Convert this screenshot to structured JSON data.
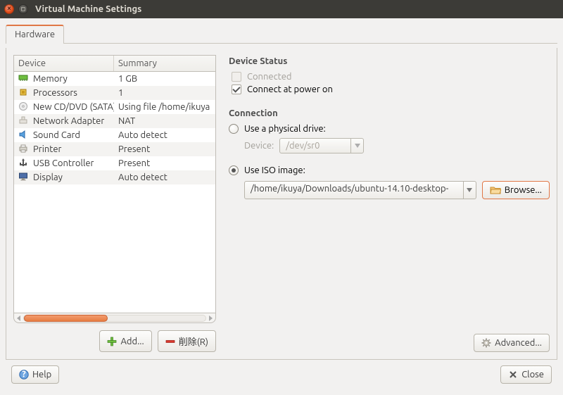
{
  "window": {
    "title": "Virtual Machine Settings"
  },
  "tabs": {
    "hardware": "Hardware"
  },
  "table": {
    "headers": {
      "device": "Device",
      "summary": "Summary"
    },
    "rows": [
      {
        "device": "Memory",
        "summary": "1 GB",
        "icon": "memory"
      },
      {
        "device": "Processors",
        "summary": "1",
        "icon": "cpu"
      },
      {
        "device": "New CD/DVD (SATA)",
        "summary": "Using file /home/ikuya",
        "icon": "disc"
      },
      {
        "device": "Network Adapter",
        "summary": "NAT",
        "icon": "net"
      },
      {
        "device": "Sound Card",
        "summary": "Auto detect",
        "icon": "sound"
      },
      {
        "device": "Printer",
        "summary": "Present",
        "icon": "printer"
      },
      {
        "device": "USB Controller",
        "summary": "Present",
        "icon": "usb"
      },
      {
        "device": "Display",
        "summary": "Auto detect",
        "icon": "display"
      }
    ]
  },
  "buttons": {
    "add": "Add...",
    "remove": "削除(R)",
    "advanced": "Advanced...",
    "help": "Help",
    "close": "Close",
    "browse": "Browse..."
  },
  "status": {
    "title": "Device Status",
    "connected": "Connected",
    "connect_poweron": "Connect at power on"
  },
  "connection": {
    "title": "Connection",
    "physical": "Use a physical drive:",
    "device_label": "Device:",
    "device_value": "/dev/sr0",
    "iso": "Use ISO image:",
    "iso_path": "/home/ikuya/Downloads/ubuntu-14.10-desktop-"
  }
}
